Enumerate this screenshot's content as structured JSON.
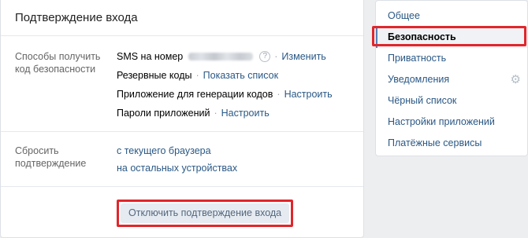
{
  "main": {
    "title": "Подтверждение входа",
    "methods": {
      "label": "Способы получить код безопасности",
      "rows": [
        {
          "text": "SMS на номер",
          "link": "Изменить"
        },
        {
          "text": "Резервные коды",
          "link": "Показать список"
        },
        {
          "text": "Приложение для генерации кодов",
          "link": "Настроить"
        },
        {
          "text": "Пароли приложений",
          "link": "Настроить"
        }
      ],
      "help_symbol": "?",
      "separator": "·"
    },
    "reset": {
      "label": "Сбросить подтверждение",
      "links": [
        "с текущего браузера",
        "на остальных устройствах"
      ]
    },
    "disable_button": "Отключить подтверждение входа"
  },
  "sidebar": {
    "items": [
      {
        "label": "Общее"
      },
      {
        "label": "Безопасность"
      },
      {
        "label": "Приватность"
      },
      {
        "label": "Уведомления"
      },
      {
        "label": "Чёрный список"
      },
      {
        "label": "Настройки приложений"
      },
      {
        "label": "Платёжные сервисы"
      }
    ],
    "active_index": 1,
    "gear_icon": "⚙"
  },
  "colors": {
    "link": "#2a5885",
    "highlight": "#e0262c",
    "background": "#edeef0"
  }
}
